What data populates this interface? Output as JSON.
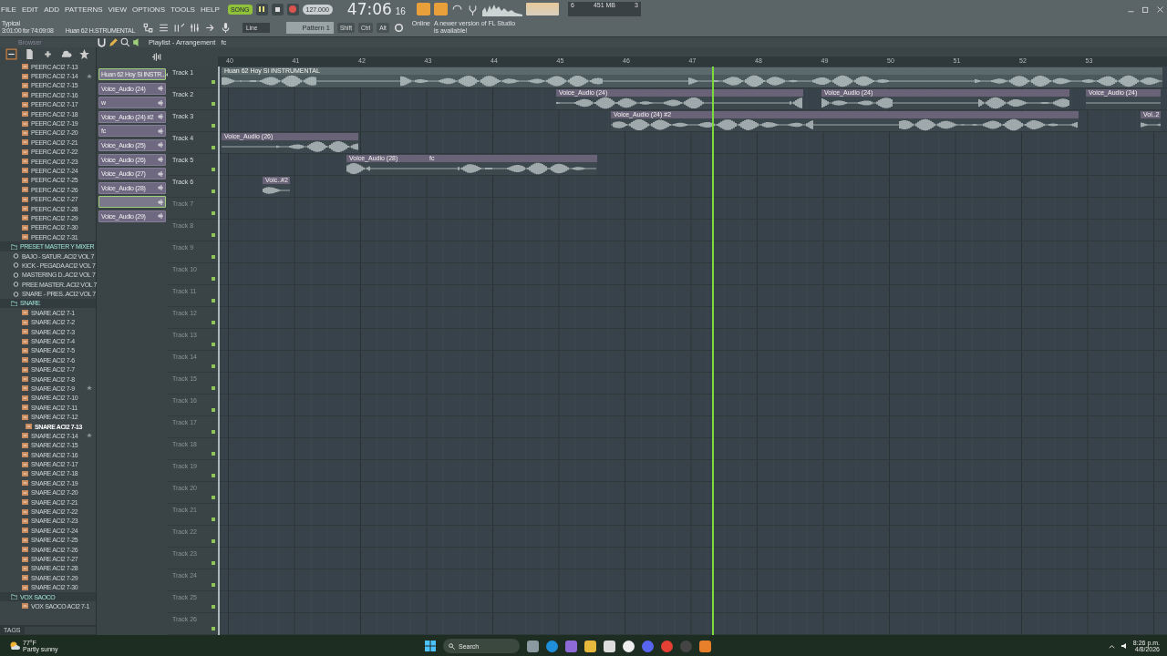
{
  "menu": [
    "FILE",
    "EDIT",
    "ADD",
    "PATTERNS",
    "VIEW",
    "OPTIONS",
    "TOOLS",
    "HELP"
  ],
  "transport": {
    "mode": "SONG",
    "tempo": "127.000"
  },
  "time": {
    "main": "47:06",
    "sub": "16"
  },
  "cpu": {
    "voices": "6",
    "memory": "451 MB",
    "count": "3"
  },
  "hint": {
    "title": "Typical",
    "text": "3:01:00 for 74:09:08",
    "target": "Huan 62 H.STRUMENTAL"
  },
  "snap": "Line",
  "pattern": "Pattern 1",
  "modifiers": [
    "Shift",
    "Ctrl",
    "Alt"
  ],
  "notice": {
    "title": "Online",
    "text": "A newer version of FL Studio is available!"
  },
  "browser": {
    "header": "Browser",
    "tags_label": "TAGS",
    "items": [
      {
        "label": "PEERC ACI2 7-13",
        "kind": "audio",
        "selected": false,
        "favorite": false
      },
      {
        "label": "PEERC ACI2 7-14",
        "kind": "audio",
        "selected": false,
        "favorite": true
      },
      {
        "label": "PEERC ACI2 7-15",
        "kind": "audio",
        "selected": false,
        "favorite": false
      },
      {
        "label": "PEERC ACI2 7-16",
        "kind": "audio",
        "selected": false,
        "favorite": false
      },
      {
        "label": "PEERC ACI2 7-17",
        "kind": "audio",
        "selected": false,
        "favorite": false
      },
      {
        "label": "PEERC ACI2 7-18",
        "kind": "audio",
        "selected": false,
        "favorite": false
      },
      {
        "label": "PEERC ACI2 7-19",
        "kind": "audio",
        "selected": false,
        "favorite": false
      },
      {
        "label": "PEERC ACI2 7-20",
        "kind": "audio",
        "selected": false,
        "favorite": false
      },
      {
        "label": "PEERC ACI2 7-21",
        "kind": "audio",
        "selected": false,
        "favorite": false
      },
      {
        "label": "PEERC ACI2 7-22",
        "kind": "audio",
        "selected": false,
        "favorite": false
      },
      {
        "label": "PEERC ACI2 7-23",
        "kind": "audio",
        "selected": false,
        "favorite": false
      },
      {
        "label": "PEERC ACI2 7-24",
        "kind": "audio",
        "selected": false,
        "favorite": false
      },
      {
        "label": "PEERC ACI2 7-25",
        "kind": "audio",
        "selected": false,
        "favorite": false
      },
      {
        "label": "PEERC ACI2 7-26",
        "kind": "audio",
        "selected": false,
        "favorite": false
      },
      {
        "label": "PEERC ACI2 7-27",
        "kind": "audio",
        "selected": false,
        "favorite": false
      },
      {
        "label": "PEERC ACI2 7-28",
        "kind": "audio",
        "selected": false,
        "favorite": false
      },
      {
        "label": "PEERC ACI2 7-29",
        "kind": "audio",
        "selected": false,
        "favorite": false
      },
      {
        "label": "PEERC ACI2 7-30",
        "kind": "audio",
        "selected": false,
        "favorite": false
      },
      {
        "label": "PEERC ACI2 7-31",
        "kind": "audio",
        "selected": false,
        "favorite": false
      },
      {
        "label": "PRESET MASTER Y MIXER",
        "kind": "folder",
        "selected": false,
        "favorite": false,
        "children": [
          {
            "label": "BAJO - SATUR..ACI2 VOL 7",
            "kind": "preset",
            "selected": false,
            "favorite": false
          },
          {
            "label": "KICK - PEGADA ACI2 VOL 7",
            "kind": "preset",
            "selected": false,
            "favorite": false
          },
          {
            "label": "MASTERING D..ACI2 VOL 7",
            "kind": "preset",
            "selected": false,
            "favorite": false
          },
          {
            "label": "PREE MASTER..ACI2 VOL 7",
            "kind": "preset",
            "selected": false,
            "favorite": false
          },
          {
            "label": "SNARE - PRES..ACI2 VOL 7",
            "kind": "preset",
            "selected": false,
            "favorite": false
          }
        ]
      },
      {
        "label": "SNARE",
        "kind": "folder",
        "selected": false,
        "favorite": false,
        "children": [
          {
            "label": "SNARE ACI2 7-1",
            "kind": "audio",
            "selected": false,
            "favorite": false
          },
          {
            "label": "SNARE ACI2 7-2",
            "kind": "audio",
            "selected": false,
            "favorite": false
          },
          {
            "label": "SNARE ACI2 7-3",
            "kind": "audio",
            "selected": false,
            "favorite": false
          },
          {
            "label": "SNARE ACI2 7-4",
            "kind": "audio",
            "selected": false,
            "favorite": false
          },
          {
            "label": "SNARE ACI2 7-5",
            "kind": "audio",
            "selected": false,
            "favorite": false
          },
          {
            "label": "SNARE ACI2 7-6",
            "kind": "audio",
            "selected": false,
            "favorite": false
          },
          {
            "label": "SNARE ACI2 7-7",
            "kind": "audio",
            "selected": false,
            "favorite": false
          },
          {
            "label": "SNARE ACI2 7-8",
            "kind": "audio",
            "selected": false,
            "favorite": false
          },
          {
            "label": "SNARE ACI2 7-9",
            "kind": "audio",
            "selected": false,
            "favorite": true
          },
          {
            "label": "SNARE ACI2 7-10",
            "kind": "audio",
            "selected": false,
            "favorite": false
          },
          {
            "label": "SNARE ACI2 7-11",
            "kind": "audio",
            "selected": false,
            "favorite": false
          },
          {
            "label": "SNARE ACI2 7-12",
            "kind": "audio",
            "selected": false,
            "favorite": false
          },
          {
            "label": "SNARE ACI2 7-13",
            "kind": "audio",
            "selected": true,
            "favorite": false
          },
          {
            "label": "SNARE ACI2 7-14",
            "kind": "audio",
            "selected": false,
            "favorite": true
          },
          {
            "label": "SNARE ACI2 7-15",
            "kind": "audio",
            "selected": false,
            "favorite": false
          },
          {
            "label": "SNARE ACI2 7-16",
            "kind": "audio",
            "selected": false,
            "favorite": false
          },
          {
            "label": "SNARE ACI2 7-17",
            "kind": "audio",
            "selected": false,
            "favorite": false
          },
          {
            "label": "SNARE ACI2 7-18",
            "kind": "audio",
            "selected": false,
            "favorite": false
          },
          {
            "label": "SNARE ACI2 7-19",
            "kind": "audio",
            "selected": false,
            "favorite": false
          },
          {
            "label": "SNARE ACI2 7-20",
            "kind": "audio",
            "selected": false,
            "favorite": false
          },
          {
            "label": "SNARE ACI2 7-21",
            "kind": "audio",
            "selected": false,
            "favorite": false
          },
          {
            "label": "SNARE ACI2 7-22",
            "kind": "audio",
            "selected": false,
            "favorite": false
          },
          {
            "label": "SNARE ACI2 7-23",
            "kind": "audio",
            "selected": false,
            "favorite": false
          },
          {
            "label": "SNARE ACI2 7-24",
            "kind": "audio",
            "selected": false,
            "favorite": false
          },
          {
            "label": "SNARE ACI2 7-25",
            "kind": "audio",
            "selected": false,
            "favorite": false
          },
          {
            "label": "SNARE ACI2 7-26",
            "kind": "audio",
            "selected": false,
            "favorite": false
          },
          {
            "label": "SNARE ACI2 7-27",
            "kind": "audio",
            "selected": false,
            "favorite": false
          },
          {
            "label": "SNARE ACI2 7-28",
            "kind": "audio",
            "selected": false,
            "favorite": false
          },
          {
            "label": "SNARE ACI2 7-29",
            "kind": "audio",
            "selected": false,
            "favorite": false
          },
          {
            "label": "SNARE ACI2 7-30",
            "kind": "audio",
            "selected": false,
            "favorite": false
          }
        ]
      },
      {
        "label": "VOX SAOCO",
        "kind": "folder",
        "selected": false,
        "favorite": false,
        "children": [
          {
            "label": "VOX SAOCO ACI2 7-1",
            "kind": "audio",
            "selected": false,
            "favorite": false
          }
        ]
      }
    ]
  },
  "playlist": {
    "title": "Playlist - Arrangement",
    "pattern": "fc",
    "ruler": [
      "40",
      "41",
      "42",
      "43",
      "44",
      "45",
      "46",
      "47",
      "48",
      "49",
      "50",
      "51",
      "52",
      "53"
    ],
    "clip_list": [
      {
        "label": "Huan 62 Hoy Si INSTR...",
        "selected": true
      },
      {
        "label": "Voice_Audio (24)",
        "selected": false
      },
      {
        "label": "w",
        "selected": false
      },
      {
        "label": "Voice_Audio (24) #2",
        "selected": false
      },
      {
        "label": "fc",
        "selected": false
      },
      {
        "label": "Voice_Audio (25)",
        "selected": false
      },
      {
        "label": "Voice_Audio (26)",
        "selected": false
      },
      {
        "label": "Voice_Audio (27)",
        "selected": false
      },
      {
        "label": "Voice_Audio (28)",
        "selected": false
      },
      {
        "selected": true
      },
      {
        "label": "Voice_Audio (29)",
        "selected": false
      }
    ],
    "tracks": [
      {
        "name": "Track 1",
        "clips": [
          {
            "label": "Huan 62 Hoy Si INSTRUMENTAL"
          }
        ]
      },
      {
        "name": "Track 2",
        "clips": [
          {
            "label": "Voice_Audio (24)"
          },
          {
            "label": "Voice_Audio (24)"
          },
          {
            "label": "Voice_Audio (24)"
          }
        ]
      },
      {
        "name": "Track 3",
        "clips": [
          {
            "label": "Voice_Audio (24) #2"
          },
          {
            "label": "Voi..2"
          }
        ]
      },
      {
        "name": "Track 4",
        "clips": [
          {
            "label": "Voice_Audio (26)"
          }
        ]
      },
      {
        "name": "Track 5",
        "clips": [
          {
            "label": "Voice_Audio (28)"
          },
          {
            "label": "fc"
          }
        ]
      },
      {
        "name": "Track 6",
        "clips": [
          {
            "label": "Voic..#2"
          }
        ]
      },
      {
        "name": "Track 7"
      },
      {
        "name": "Track 8"
      },
      {
        "name": "Track 9"
      },
      {
        "name": "Track 10"
      },
      {
        "name": "Track 11"
      },
      {
        "name": "Track 12"
      },
      {
        "name": "Track 13"
      },
      {
        "name": "Track 14"
      },
      {
        "name": "Track 15"
      },
      {
        "name": "Track 16"
      },
      {
        "name": "Track 17"
      },
      {
        "name": "Track 18"
      },
      {
        "name": "Track 19"
      },
      {
        "name": "Track 20"
      },
      {
        "name": "Track 21"
      },
      {
        "name": "Track 22"
      },
      {
        "name": "Track 23"
      },
      {
        "name": "Track 24"
      },
      {
        "name": "Track 25"
      },
      {
        "name": "Track 26"
      }
    ]
  },
  "taskbar": {
    "temperature": "77°F",
    "weather": "Partly sunny",
    "search": "Search",
    "time": "8:26 p.m.",
    "date": "4/8/2026"
  }
}
